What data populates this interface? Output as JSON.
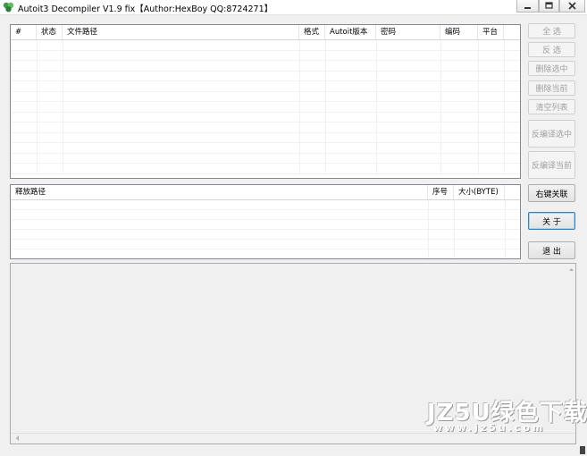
{
  "window": {
    "title": "Autoit3 Decompiler V1.9 fix【Author:HexBoy  QQ:8724271】"
  },
  "file_list": {
    "columns": [
      "#",
      "状态",
      "文件路径",
      "格式",
      "Autoit版本",
      "密码",
      "编码",
      "平台"
    ],
    "rows": []
  },
  "release_list": {
    "columns": [
      "释放路径",
      "序号",
      "大小(BYTE)"
    ],
    "rows": []
  },
  "buttons": {
    "select_all": "全  选",
    "invert_select": "反  选",
    "delete_selected": "删除选中",
    "delete_current": "删除当前",
    "clear_list": "清空列表",
    "decompile_selected": "反编译选中",
    "decompile_current": "反编译当前",
    "context_menu_assoc": "右键关联",
    "about": "关  于",
    "exit": "退  出"
  },
  "watermark": {
    "main": "JZ5U绿色下载",
    "sub": "www.jz5u.com"
  }
}
